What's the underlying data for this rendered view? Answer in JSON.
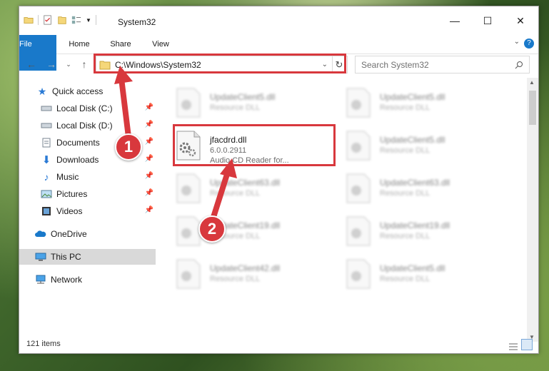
{
  "window": {
    "title": "System32"
  },
  "window_controls": {
    "minimize": "—",
    "maximize": "☐",
    "close": "✕"
  },
  "ribbon": {
    "tabs": [
      "File",
      "Home",
      "Share",
      "View"
    ]
  },
  "nav": {
    "address": "C:\\Windows\\System32",
    "search_placeholder": "Search System32"
  },
  "sidebar": {
    "items": [
      {
        "label": "Quick access"
      },
      {
        "label": "Local Disk (C:)"
      },
      {
        "label": "Local Disk (D:)"
      },
      {
        "label": "Documents"
      },
      {
        "label": "Downloads"
      },
      {
        "label": "Music"
      },
      {
        "label": "Pictures"
      },
      {
        "label": "Videos"
      },
      {
        "label": "OneDrive"
      },
      {
        "label": "This PC"
      },
      {
        "label": "Network"
      }
    ]
  },
  "files": {
    "focused": {
      "name": "jfacdrd.dll",
      "version": "6.0.0.2911",
      "desc": "Audio CD Reader for..."
    },
    "blurred": [
      {
        "name": "UpdateClient5.dll",
        "desc": "Resource DLL"
      },
      {
        "name": "UpdateClient5.dll",
        "desc": "Resource DLL"
      },
      {
        "name": "UpdateClient5.dll",
        "desc": "Resource DLL"
      },
      {
        "name": "UpdateClient63.dll",
        "desc": "Resource DLL"
      },
      {
        "name": "UpdateClient63.dll",
        "desc": "Resource DLL"
      },
      {
        "name": "UpdateClient19.dll",
        "desc": "Resource DLL"
      },
      {
        "name": "UpdateClient19.dll",
        "desc": "Resource DLL"
      },
      {
        "name": "UpdateClient42.dll",
        "desc": "Resource DLL"
      },
      {
        "name": "UpdateClient5.dll",
        "desc": "Resource DLL"
      }
    ]
  },
  "status": {
    "count": "121 items"
  },
  "callouts": [
    "1",
    "2"
  ],
  "colors": {
    "accent": "#1979ca",
    "highlight": "#d8383d"
  }
}
